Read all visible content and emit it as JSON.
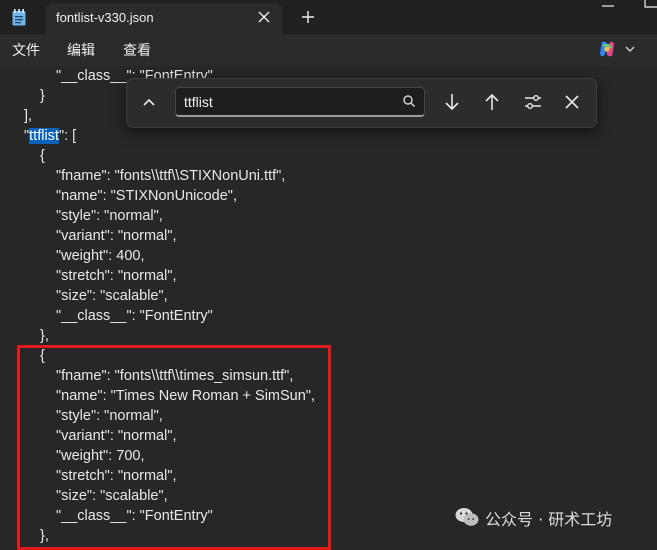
{
  "tab": {
    "title": "fontlist-v330.json"
  },
  "menu": {
    "items": [
      "文件",
      "编辑",
      "查看"
    ]
  },
  "find": {
    "query": "ttflist"
  },
  "editor": {
    "lines": [
      {
        "indent": "    ",
        "text": "\"__class__\": \"FontEntry\""
      },
      {
        "indent": "  ",
        "text": "}"
      },
      {
        "indent": "",
        "text": "],"
      },
      {
        "indent": "",
        "pre": "\"",
        "match": "ttflist",
        "post": "\": ["
      },
      {
        "indent": "  ",
        "text": "{"
      },
      {
        "indent": "    ",
        "text": "\"fname\": \"fonts\\\\ttf\\\\STIXNonUni.ttf\","
      },
      {
        "indent": "    ",
        "text": "\"name\": \"STIXNonUnicode\","
      },
      {
        "indent": "    ",
        "text": "\"style\": \"normal\","
      },
      {
        "indent": "    ",
        "text": "\"variant\": \"normal\","
      },
      {
        "indent": "    ",
        "text": "\"weight\": 400,"
      },
      {
        "indent": "    ",
        "text": "\"stretch\": \"normal\","
      },
      {
        "indent": "    ",
        "text": "\"size\": \"scalable\","
      },
      {
        "indent": "    ",
        "text": "\"__class__\": \"FontEntry\""
      },
      {
        "indent": "  ",
        "text": "},"
      },
      {
        "indent": "  ",
        "text": "{"
      },
      {
        "indent": "    ",
        "text": "\"fname\": \"fonts\\\\ttf\\\\times_simsun.ttf\","
      },
      {
        "indent": "    ",
        "text": "\"name\": \"Times New Roman + SimSun\","
      },
      {
        "indent": "    ",
        "text": "\"style\": \"normal\","
      },
      {
        "indent": "    ",
        "text": "\"variant\": \"normal\","
      },
      {
        "indent": "    ",
        "text": "\"weight\": 700,"
      },
      {
        "indent": "    ",
        "text": "\"stretch\": \"normal\","
      },
      {
        "indent": "    ",
        "text": "\"size\": \"scalable\","
      },
      {
        "indent": "    ",
        "text": "\"__class__\": \"FontEntry\""
      },
      {
        "indent": "  ",
        "text": "},"
      }
    ]
  },
  "watermark": {
    "text": "公众号 · 研术工坊"
  },
  "colors": {
    "highlight": "#0a63b8",
    "annotation_box": "#e01b1b",
    "background": "#272727"
  }
}
